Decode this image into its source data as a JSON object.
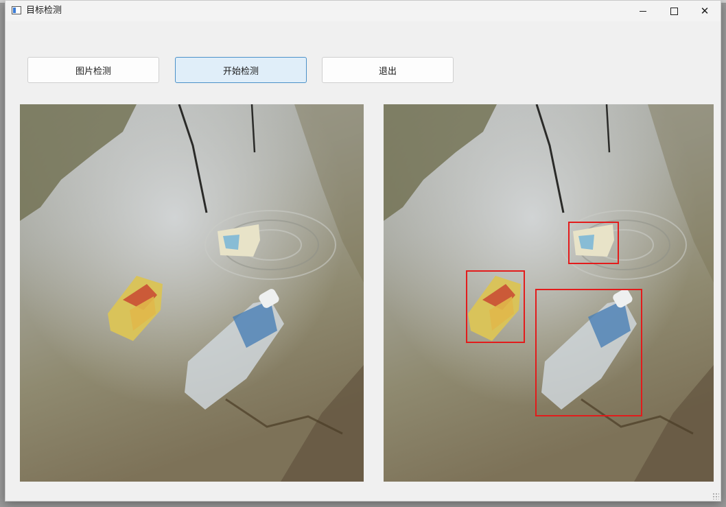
{
  "window": {
    "title": "目标检测",
    "controls": {
      "minimize_icon": "minimize-icon",
      "maximize_icon": "maximize-icon",
      "close_icon": "close-icon",
      "close_glyph": "✕"
    }
  },
  "toolbar": {
    "image_detect_label": "图片检测",
    "start_detect_label": "开始检测",
    "exit_label": "退出"
  },
  "panels": {
    "original": {
      "content": "photo of floating litter on pond water: paper carton, snack wrapper, plastic bottle"
    },
    "result": {
      "detections": 3,
      "box_color": "#e31b1b"
    }
  },
  "colors": {
    "window_bg": "#f0f0f0",
    "accent_button_bg": "#e0eef9",
    "accent_button_border": "#4a90c8"
  }
}
